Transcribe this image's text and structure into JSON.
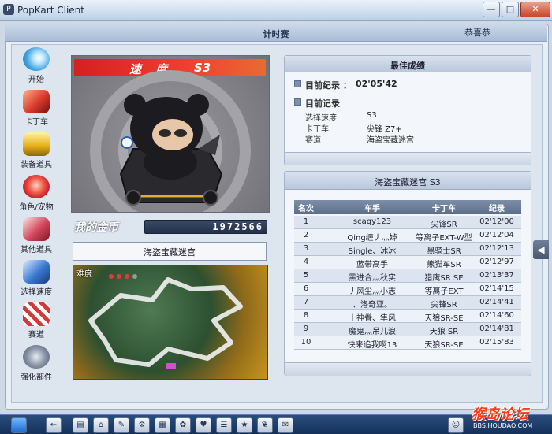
{
  "window": {
    "app_title": "PopKart Client",
    "minimize": "—",
    "maximize": "□",
    "close": "✕"
  },
  "header": {
    "title": "计时赛",
    "user": "恭喜恭"
  },
  "menu": {
    "items": [
      {
        "label": "开始",
        "icon": "play-icon",
        "color": "#3fa4e0"
      },
      {
        "label": "卡丁车",
        "icon": "kart-icon",
        "color": "#d83a2a"
      },
      {
        "label": "装备道具",
        "icon": "goggles-icon",
        "color": "#e9b21c"
      },
      {
        "label": "角色/宠物",
        "icon": "character-icon",
        "color": "#c8202e"
      },
      {
        "label": "其他道具",
        "icon": "gift-icon",
        "color": "#d1465a"
      },
      {
        "label": "选择速度",
        "icon": "speed-icon",
        "color": "#3a78d0"
      },
      {
        "label": "赛道",
        "icon": "track-icon",
        "color": "#d23a3a"
      },
      {
        "label": "强化部件",
        "icon": "parts-icon",
        "color": "#8a95a8"
      }
    ]
  },
  "speed": {
    "label": "速度",
    "class": "S3"
  },
  "coins": {
    "label": "我的金币",
    "value": "1972566"
  },
  "track": {
    "name": "海盗宝藏迷宫",
    "map_label": "难度"
  },
  "best_record": {
    "title": "最佳成绩",
    "current_record_label": "目前纪录 ：",
    "current_record_value": "02'05'42",
    "current_log_label": "目前记录",
    "rows": [
      {
        "label": "选择速度",
        "value": "S3"
      },
      {
        "label": "卡丁车",
        "value": "尖锋 Z7+"
      },
      {
        "label": "赛道",
        "value": "海盗宝藏迷宫"
      }
    ]
  },
  "ranking": {
    "title": "海盗宝藏迷宫 S3",
    "columns": [
      "名次",
      "车手",
      "卡丁车",
      "纪录"
    ],
    "rows": [
      {
        "rank": "1",
        "driver": "scaqy123",
        "kart": "尖锋SR",
        "time": "02'12'00"
      },
      {
        "rank": "2",
        "driver": "Qing缠丿灬婥",
        "kart": "等离子EXT-W型",
        "time": "02'12'04"
      },
      {
        "rank": "3",
        "driver": "Single、冰冰",
        "kart": "黑骑士SR",
        "time": "02'12'13"
      },
      {
        "rank": "4",
        "driver": "蓝带高手",
        "kart": "熊猫车SR",
        "time": "02'12'97"
      },
      {
        "rank": "5",
        "driver": "黑进合灬秋实",
        "kart": "猎鹰SR SE",
        "time": "02'13'37"
      },
      {
        "rank": "6",
        "driver": "丿风尘灬小志",
        "kart": "等离子EXT",
        "time": "02'14'15"
      },
      {
        "rank": "7",
        "driver": "、洛奇亚。",
        "kart": "尖锋SR",
        "time": "02'14'41"
      },
      {
        "rank": "8",
        "driver": "丨神眷、隼风",
        "kart": "天狼SR-SE",
        "time": "02'14'60"
      },
      {
        "rank": "9",
        "driver": "魔鬼灬吊儿浪",
        "kart": "天狼 SR",
        "time": "02'14'81"
      },
      {
        "rank": "10",
        "driver": "快来追我啊13",
        "kart": "天狼SR-SE",
        "time": "02'15'83"
      }
    ]
  },
  "side_tab": "◀",
  "watermark": {
    "text": "猴岛论坛",
    "url": "BBS.HOUDAO.COM"
  }
}
